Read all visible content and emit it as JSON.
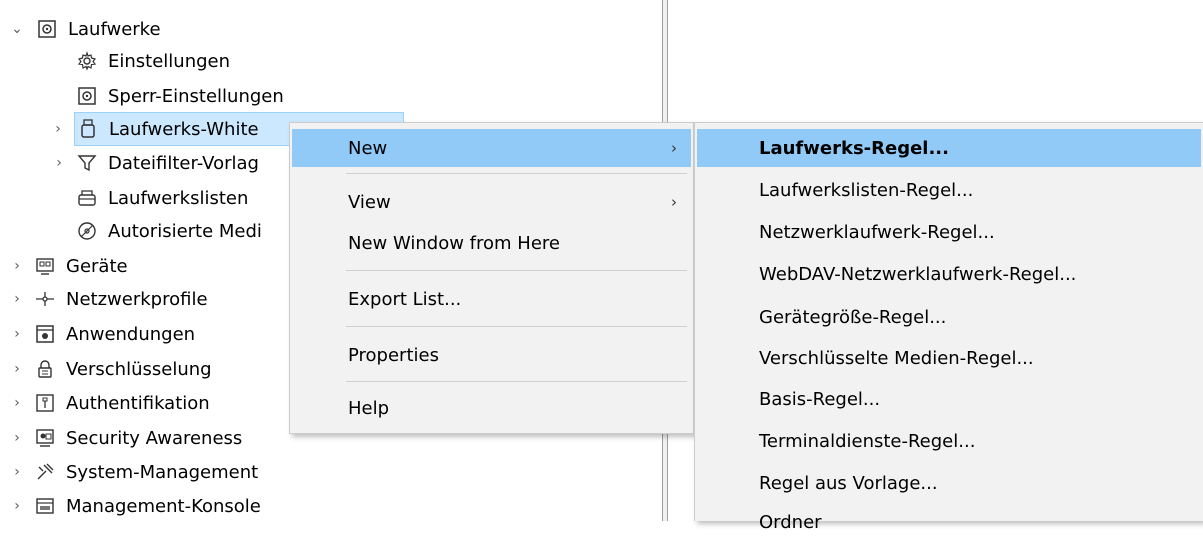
{
  "tree": {
    "items": [
      {
        "label": "Laufwerke",
        "icon": "drive-icon",
        "expanded": true
      },
      {
        "label": "Einstellungen",
        "icon": "gear-icon"
      },
      {
        "label": "Sperr-Einstellungen",
        "icon": "lock-drive-icon"
      },
      {
        "label": "Laufwerks-White",
        "icon": "usb-stick-icon",
        "selected": true
      },
      {
        "label": "Dateifilter-Vorlag",
        "icon": "funnel-icon"
      },
      {
        "label": "Laufwerkslisten",
        "icon": "drive-list-icon"
      },
      {
        "label": "Autorisierte Medi",
        "icon": "authorized-media-icon"
      },
      {
        "label": "Geräte",
        "icon": "devices-icon"
      },
      {
        "label": "Netzwerkprofile",
        "icon": "network-icon"
      },
      {
        "label": "Anwendungen",
        "icon": "application-icon"
      },
      {
        "label": "Verschlüsselung",
        "icon": "padlock-icon"
      },
      {
        "label": "Authentifikation",
        "icon": "authentication-icon"
      },
      {
        "label": "Security Awareness",
        "icon": "security-awareness-icon"
      },
      {
        "label": "System-Management",
        "icon": "system-management-icon"
      },
      {
        "label": "Management-Konsole",
        "icon": "console-icon"
      }
    ]
  },
  "context_menu": {
    "items": [
      "New",
      "View",
      "New Window from Here",
      "Export List...",
      "Properties",
      "Help"
    ],
    "highlighted": "New"
  },
  "submenu": {
    "items": [
      "Laufwerks-Regel...",
      "Laufwerkslisten-Regel...",
      "Netzwerklaufwerk-Regel...",
      "WebDAV-Netzwerklaufwerk-Regel...",
      "Gerätegröße-Regel...",
      "Verschlüsselte Medien-Regel...",
      "Basis-Regel...",
      "Terminaldienste-Regel...",
      "Regel aus Vorlage...",
      "Ordner"
    ],
    "highlighted": "Laufwerks-Regel..."
  },
  "colors": {
    "menu_highlight": "#91c9f7",
    "tree_selection": "#cce8ff",
    "menu_background": "#f2f2f2"
  }
}
